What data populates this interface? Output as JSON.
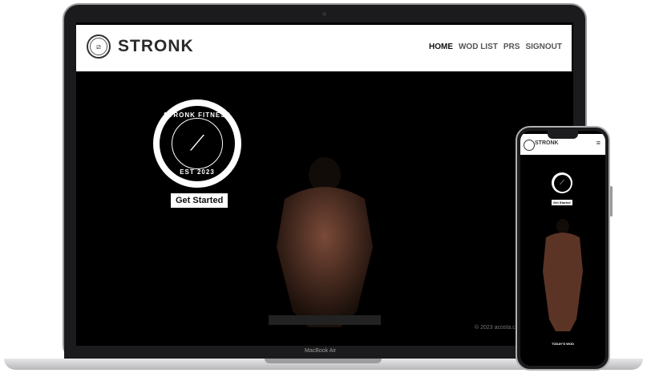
{
  "laptop": {
    "brand": {
      "logo_icon": "stronk-badge-icon",
      "name": "STRONK"
    },
    "nav": [
      {
        "label": "HOME",
        "active": true
      },
      {
        "label": "WOD LIST",
        "active": false
      },
      {
        "label": "PRS",
        "active": false
      },
      {
        "label": "SIGNOUT",
        "active": false
      }
    ],
    "hero": {
      "badge_top": "STRONK FITNESS",
      "badge_bottom": "EST 2023",
      "cta_label": "Get Started"
    },
    "copyright": "© 2023 acosta.code",
    "device_label": "MacBook Air"
  },
  "phone": {
    "brand": "STRONK",
    "menu_icon": "hamburger-menu-icon",
    "cta_label": "Get Started",
    "wod_label": "TODAY'S WOD"
  },
  "colors": {
    "header_bg": "#ffffff",
    "screen_bg": "#000000",
    "device_frame": "#1b1b1d"
  }
}
